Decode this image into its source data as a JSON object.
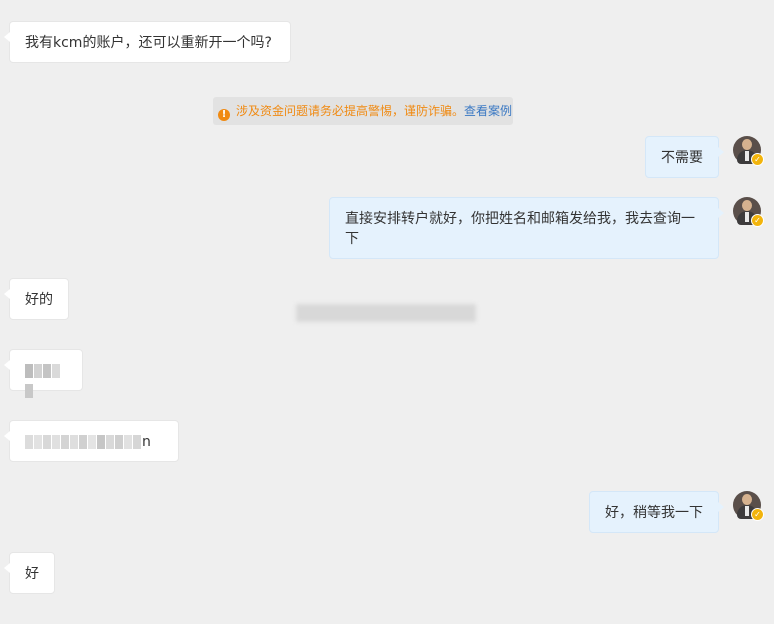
{
  "messages": {
    "m1": "我有kcm的账户，还可以重新开一个吗?",
    "m2": "不需要",
    "m3": "直接安排转户就好，你把姓名和邮箱发给我，我去查询一下",
    "m4": "好的",
    "m5_suffix": "n",
    "m6": "好，稍等我一下",
    "m7": "好"
  },
  "notice": {
    "text": "涉及资金问题请务必提高警惕，谨防诈骗。",
    "link": "查看案例",
    "icon": "warning-icon"
  },
  "colors": {
    "background": "#efefef",
    "bubble_left": "#ffffff",
    "bubble_right": "#e5f2fd",
    "notice_text": "#f08a12",
    "notice_link": "#3a78c3",
    "badge": "#f2b40c"
  }
}
